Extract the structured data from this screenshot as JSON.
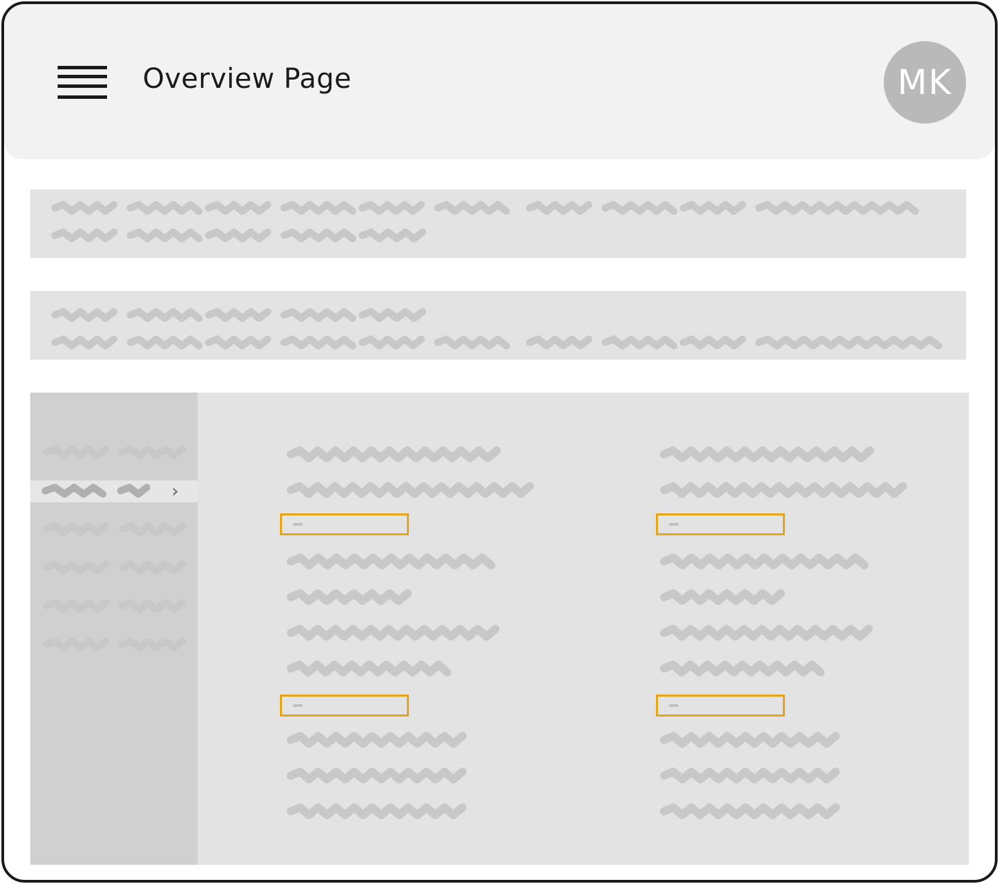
{
  "header": {
    "title": "Overview Page",
    "avatar_initials": "MK",
    "menu_icon": "hamburger-menu-icon"
  },
  "colors": {
    "frame": "#1a1a1a",
    "header_bg": "#f2f2f2",
    "panel_bg": "#e3e3e3",
    "sidebar_bg": "#d0d0d0",
    "avatar_bg": "#b9b9b9",
    "highlight": "#e8a419",
    "placeholder_text": "#c8c8c8"
  },
  "sidebar": {
    "item_count": 6,
    "active_index": 1,
    "active_icon": "chevron-right-icon"
  },
  "content": {
    "highlight_fields": 4
  }
}
